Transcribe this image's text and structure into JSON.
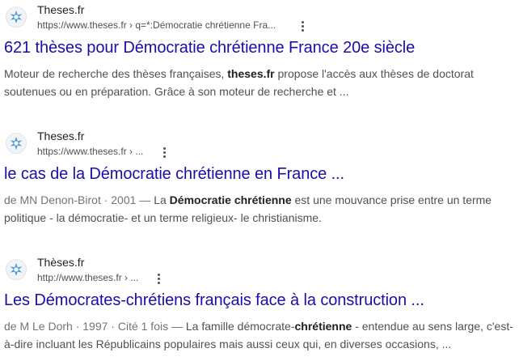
{
  "results": [
    {
      "site_name": "Theses.fr",
      "url": "https://www.theses.fr › q=*:Démocratie chrétienne Fra...",
      "favicon": "theses-star-icon",
      "title": "621 thèses pour Démocratie chrétienne France 20e siècle",
      "snippet": {
        "p1": "Moteur de recherche des thèses françaises, ",
        "b1": "theses.fr",
        "p2": " propose l'accès aux thèses de doctorat soutenues ou en préparation. Grâce à son moteur de recherche et ..."
      }
    },
    {
      "site_name": "Theses.fr",
      "url": "https://www.theses.fr › ...",
      "favicon": "theses-star-icon",
      "title": "le cas de la Démocratie chrétienne en France ...",
      "snippet": {
        "meta": "de MN Denon-Birot · 2001 — ",
        "p1": "La ",
        "b1": "Démocratie chrétienne",
        "p2": " est une mouvance prise entre un terme politique - la démocratie- et un terme religieux- le christianisme."
      }
    },
    {
      "site_name": "Thèses.fr",
      "url": "http://www.theses.fr › ...",
      "favicon": "theses-star-icon",
      "title": "Les Démocrates-chrétiens français face à la construction ...",
      "snippet": {
        "meta": "de M Le Dorh · 1997 · Cité 1 fois — ",
        "p1": "La famille démocrate-",
        "b1": "chrétienne",
        "p2": " - entendue au sens large, c'est-à-dire incluant les Républicains populaires mais aussi ceux qui, en diverses occasions, ..."
      }
    }
  ],
  "colors": {
    "title_link": "#1a0dab",
    "snippet_text": "#4d5156",
    "favicon_star": "#4a9bd6"
  }
}
